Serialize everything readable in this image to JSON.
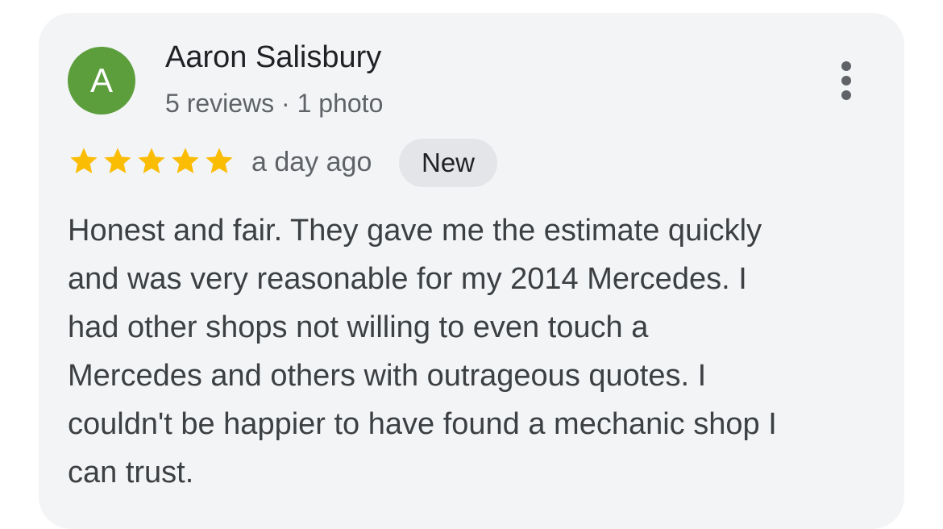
{
  "review": {
    "author": {
      "initial": "A",
      "name": "Aaron Salisbury",
      "meta": "5 reviews · 1 photo",
      "avatar_color": "#5d9e3c"
    },
    "rating": 5,
    "star_color": "#fbbc04",
    "time": "a day ago",
    "badge": "New",
    "more_icon": "more-vert-icon",
    "text_lines": [
      "Honest and fair. They gave me the estimate quickly",
      "and was very reasonable for my 2014 Mercedes. I",
      "had other shops not willing to even touch a",
      "Mercedes and others with outrageous quotes. I",
      "couldn't be happier to have found a mechanic shop I",
      "can trust."
    ]
  }
}
